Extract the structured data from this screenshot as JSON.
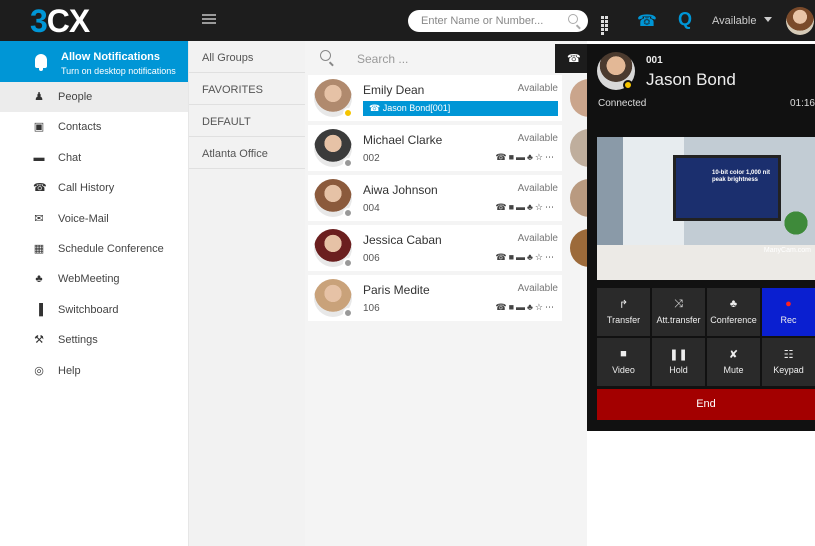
{
  "app": {
    "logo_prefix": "3",
    "logo_suffix": "CX"
  },
  "topbar": {
    "search_placeholder": "Enter Name or Number...",
    "queue_label": "Q",
    "status": "Available"
  },
  "notification": {
    "title": "Allow Notifications",
    "subtitle": "Turn on desktop notifications"
  },
  "nav": [
    {
      "label": "People",
      "icon": "person-icon",
      "glyph": "♟",
      "active": true
    },
    {
      "label": "Contacts",
      "icon": "contacts-icon",
      "glyph": "▣",
      "active": false
    },
    {
      "label": "Chat",
      "icon": "chat-icon",
      "glyph": "▬",
      "active": false
    },
    {
      "label": "Call History",
      "icon": "phone-icon",
      "glyph": "☎",
      "active": false
    },
    {
      "label": "Voice-Mail",
      "icon": "envelope-icon",
      "glyph": "✉",
      "active": false
    },
    {
      "label": "Schedule Conference",
      "icon": "calendar-icon",
      "glyph": "▦",
      "active": false
    },
    {
      "label": "WebMeeting",
      "icon": "group-icon",
      "glyph": "♣",
      "active": false
    },
    {
      "label": "Switchboard",
      "icon": "bars-icon",
      "glyph": "▐",
      "active": false
    },
    {
      "label": "Settings",
      "icon": "wrench-icon",
      "glyph": "⚒",
      "active": false
    },
    {
      "label": "Help",
      "icon": "help-icon",
      "glyph": "◎",
      "active": false
    }
  ],
  "groups": [
    "All Groups",
    "FAVORITES",
    "DEFAULT",
    "Atlanta Office"
  ],
  "contact_search_placeholder": "Search ...",
  "contacts": [
    {
      "name": "Emily Dean",
      "status": "Available",
      "ext": "",
      "call_label": "Jason Bond[001]",
      "presence": "yellow",
      "avatar_color": "#b08a6e"
    },
    {
      "name": "Michael Clarke",
      "status": "Available",
      "ext": "002",
      "call_label": "",
      "presence": "grey",
      "avatar_color": "#3b3b3b"
    },
    {
      "name": "Aiwa Johnson",
      "status": "Available",
      "ext": "004",
      "call_label": "",
      "presence": "grey",
      "avatar_color": "#8b5a3c"
    },
    {
      "name": "Jessica Caban",
      "status": "Available",
      "ext": "006",
      "call_label": "",
      "presence": "grey",
      "avatar_color": "#6b1f1f"
    },
    {
      "name": "Paris Medite",
      "status": "Available",
      "ext": "106",
      "call_label": "",
      "presence": "grey",
      "avatar_color": "#c9a27a"
    }
  ],
  "call": {
    "extension": "001",
    "name": "Jason Bond",
    "status": "Connected",
    "timer": "01:16",
    "video_text": "10-bit color 1,000 nit peak brightness",
    "watermark": "ManyCam.com",
    "buttons": [
      {
        "label": "Transfer",
        "icon": "transfer-icon",
        "glyph": "↱"
      },
      {
        "label": "Att.transfer",
        "icon": "shuffle-icon",
        "glyph": "⤨"
      },
      {
        "label": "Conference",
        "icon": "conference-icon",
        "glyph": "♣"
      },
      {
        "label": "Rec",
        "icon": "record-icon",
        "glyph": "●"
      },
      {
        "label": "Video",
        "icon": "video-icon",
        "glyph": "■"
      },
      {
        "label": "Hold",
        "icon": "pause-icon",
        "glyph": "❚❚"
      },
      {
        "label": "Mute",
        "icon": "mute-icon",
        "glyph": "✘"
      },
      {
        "label": "Keypad",
        "icon": "keypad-icon",
        "glyph": "☷"
      }
    ],
    "end_label": "End"
  }
}
